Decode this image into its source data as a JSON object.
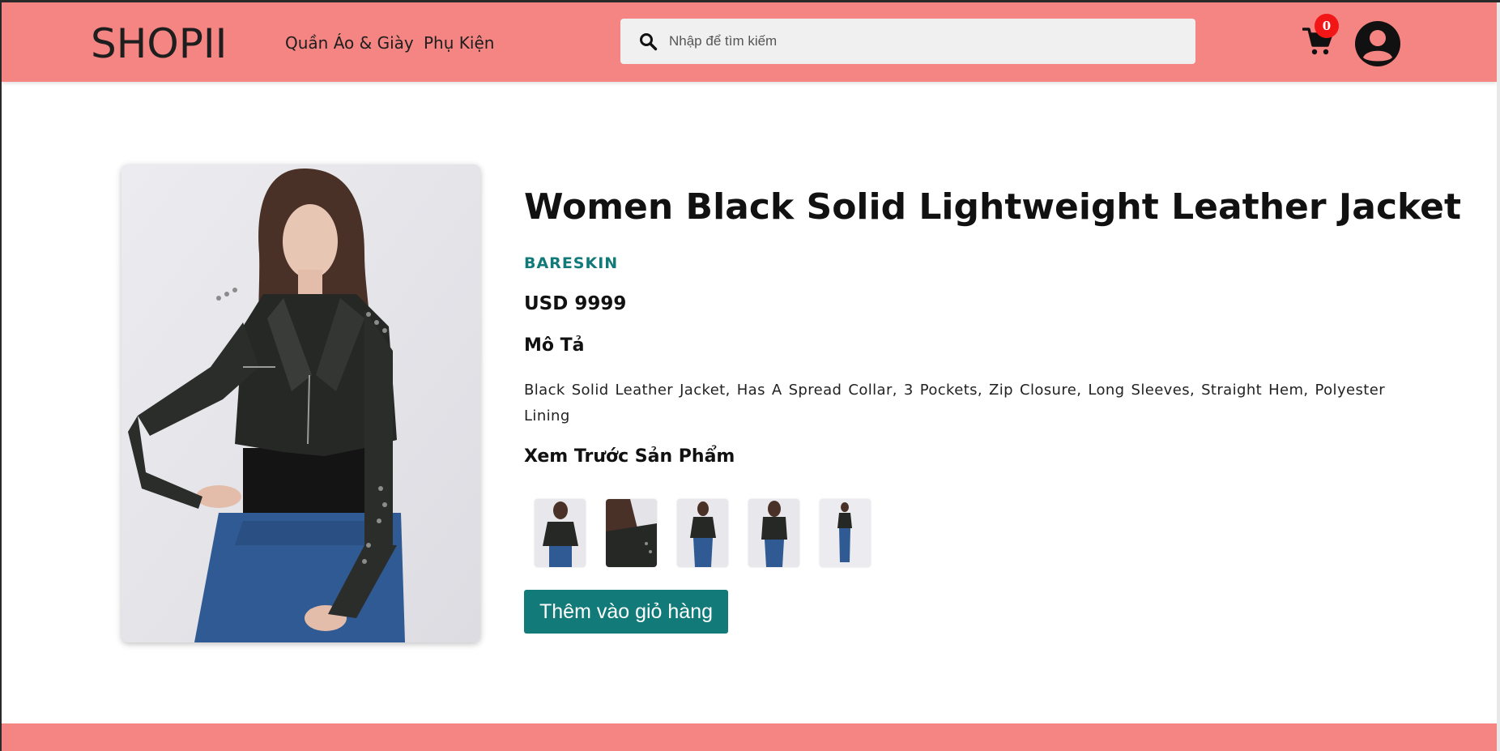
{
  "header": {
    "logo": "SHOPII",
    "nav": [
      "Quần Áo & Giày",
      "Phụ Kiện"
    ],
    "search_placeholder": "Nhập để tìm kiếm",
    "cart_count": "0",
    "icons": {
      "search": "search-icon",
      "cart": "cart-icon",
      "account": "user-avatar-icon"
    }
  },
  "product": {
    "title": "Women Black Solid Lightweight Leather Jacket",
    "brand": "BARESKIN",
    "price": "USD 9999",
    "description_heading": "Mô Tả",
    "description": "Black Solid Leather Jacket, Has A Spread Collar, 3 Pockets, Zip Closure, Long Sleeves, Straight Hem, Polyester Lining",
    "preview_heading": "Xem Trước Sản Phẩm",
    "thumbnail_count": 5,
    "add_to_cart_label": "Thêm vào giỏ hàng"
  },
  "colors": {
    "header_bg": "#f48583",
    "accent": "#137a7a",
    "badge": "#f21616"
  }
}
